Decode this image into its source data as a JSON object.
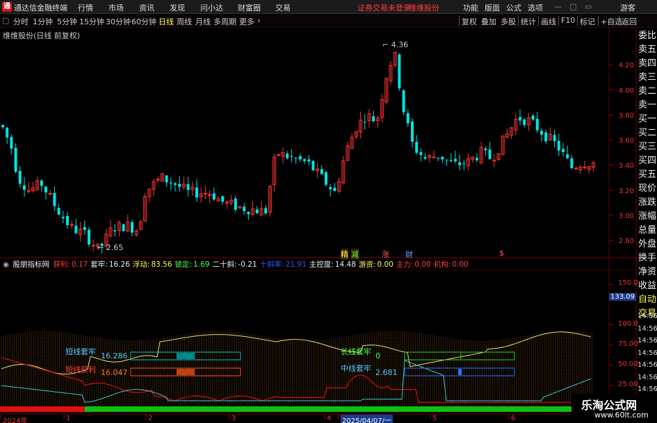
{
  "titlebar": {
    "app_title": "通达信金融终端",
    "menus": [
      "行情",
      "市场",
      "资讯",
      "发现",
      "问小达",
      "财富圈",
      "交易"
    ],
    "warning": "证券交易未登录",
    "stock": "维维股份",
    "right_menus": [
      "功能",
      "版面",
      "公式",
      "选项"
    ],
    "user": "游客"
  },
  "toolbar": {
    "periods": [
      "分时",
      "1分钟",
      "5分钟",
      "15分钟",
      "30分钟",
      "60分钟",
      "日线",
      "周线",
      "月线",
      "多周期",
      "更多"
    ],
    "active": "日线",
    "right_buttons": [
      "复权",
      "叠加",
      "多股",
      "统计",
      "画线",
      "F10",
      "标记",
      "+自选",
      "返回"
    ]
  },
  "stock_title": "维维股份(日线 前复权)",
  "sidebar": {
    "items": [
      "委比",
      "卖五",
      "卖四",
      "卖三",
      "卖二",
      "卖一",
      "买一",
      "买二",
      "买三",
      "买四",
      "买五",
      "现价",
      "涨跌",
      "涨幅",
      "总量",
      "外盘",
      "换手",
      "净资",
      "收益",
      "自动",
      "交易"
    ]
  },
  "price_axis": {
    "labels": [
      "4.20",
      "4.00",
      "3.80",
      "3.60",
      "3.40",
      "3.20",
      "3.00",
      "2.80"
    ],
    "values": [
      4.2,
      4.0,
      3.8,
      3.6,
      3.4,
      3.2,
      3.0,
      2.8
    ],
    "range": [
      2.69,
      4.45
    ]
  },
  "markers": {
    "high": "4.36",
    "low": "2.65",
    "buy_marks": [
      "精",
      "减",
      "涨",
      "财"
    ],
    "dollar": "$"
  },
  "indicator": {
    "name": "股朋指标网",
    "items": [
      {
        "label": "获利:",
        "value": "0.17",
        "color": "#ff4040"
      },
      {
        "label": "套牢:",
        "value": "16.26",
        "color": "#f0f0f0"
      },
      {
        "label": "浮动:",
        "value": "83.56",
        "color": "#ffff55"
      },
      {
        "label": "锁定:",
        "value": "1.69",
        "color": "#55ff55"
      },
      {
        "label": "二十斜:",
        "value": "-0.21",
        "color": "#f0f0f0"
      },
      {
        "label": "十斜率:",
        "value": "21.91",
        "color": "#3355ff"
      },
      {
        "label": "主控度:",
        "value": "14.48",
        "color": "#f0f0f0"
      },
      {
        "label": "游资:",
        "value": "0.00",
        "color": "#ffff55"
      },
      {
        "label": "主力:",
        "value": "0.00",
        "color": "#ff4040"
      },
      {
        "label": "机构:",
        "value": "0.00",
        "color": "#ff4040"
      }
    ]
  },
  "ind_axis": {
    "labels": [
      "150.0",
      "133.09",
      "100.0",
      "75.00",
      "50.00",
      "25.00"
    ],
    "values": [
      150,
      133.09,
      100,
      75,
      50,
      25
    ],
    "range": [
      0,
      165
    ]
  },
  "boxes": {
    "short_trap_label": "短线套牢",
    "short_trap_value": "16.286",
    "short_profit_label": "短线获利",
    "short_profit_value": "16.047",
    "long_trap_label": "长线套牢",
    "long_trap_value": "0",
    "mid_trap_label": "中线套牢",
    "mid_trap_value": "2.681"
  },
  "right_times": [
    "14:56",
    "14:56",
    "14:56",
    "14:56",
    "14:56",
    "14:56",
    "14:56",
    "14:56",
    "14:56"
  ],
  "dates": [
    "2024年",
    "1",
    "2",
    "3",
    "4",
    "2025/04/07/一",
    "5",
    "6"
  ],
  "watermark": {
    "site": "乐淘公式网",
    "url": "www.60lt.com"
  },
  "colors": {
    "up": "#ff3333",
    "down": "#00e4e4",
    "bg": "#000000"
  }
}
